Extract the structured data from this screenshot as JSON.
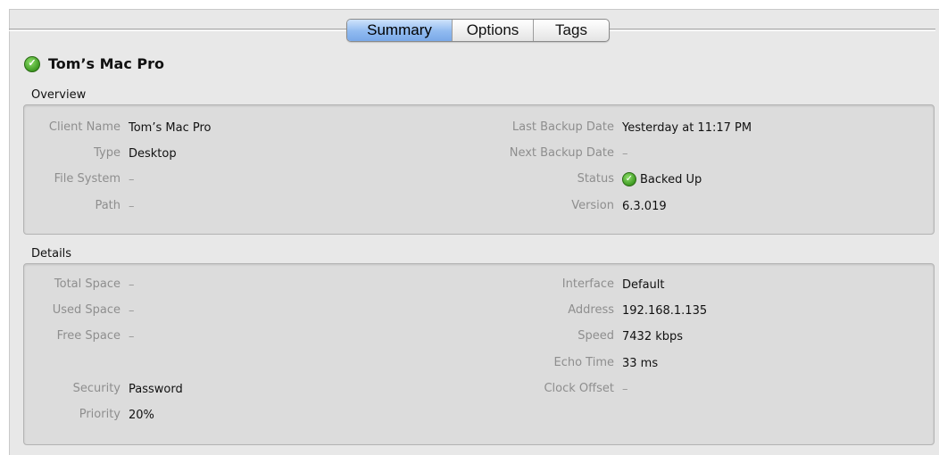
{
  "tabs": {
    "summary": "Summary",
    "options": "Options",
    "tags": "Tags"
  },
  "title": "Tom’s Mac Pro",
  "overview": {
    "label": "Overview",
    "client_name": {
      "label": "Client Name",
      "value": "Tom’s Mac Pro"
    },
    "type": {
      "label": "Type",
      "value": "Desktop"
    },
    "file_system": {
      "label": "File System",
      "value": "–"
    },
    "path": {
      "label": "Path",
      "value": "–"
    },
    "last_backup": {
      "label": "Last Backup Date",
      "value": "Yesterday at 11:17 PM"
    },
    "next_backup": {
      "label": "Next Backup Date",
      "value": "–"
    },
    "status": {
      "label": "Status",
      "value": "Backed Up",
      "icon": "green-check-icon"
    },
    "version": {
      "label": "Version",
      "value": "6.3.019"
    }
  },
  "details": {
    "label": "Details",
    "total_space": {
      "label": "Total Space",
      "value": "–"
    },
    "used_space": {
      "label": "Used Space",
      "value": "–"
    },
    "free_space": {
      "label": "Free Space",
      "value": "–"
    },
    "security": {
      "label": "Security",
      "value": "Password"
    },
    "priority": {
      "label": "Priority",
      "value": "20%"
    },
    "interface": {
      "label": "Interface",
      "value": "Default"
    },
    "address": {
      "label": "Address",
      "value": "192.168.1.135"
    },
    "speed": {
      "label": "Speed",
      "value": "7432 kbps"
    },
    "echo_time": {
      "label": "Echo Time",
      "value": "33 ms"
    },
    "clock_offset": {
      "label": "Clock Offset",
      "value": "–"
    }
  },
  "colors": {
    "tab_selected": "#90baf0",
    "status_green": "#3f9a23",
    "label_gray": "#8e8e8e"
  }
}
